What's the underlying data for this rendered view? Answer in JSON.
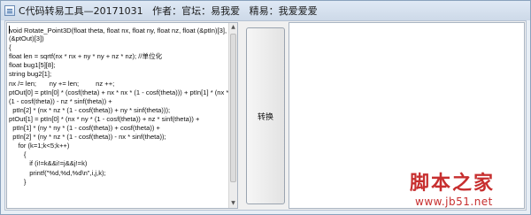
{
  "window": {
    "title": "C代码转易工具—20171031   作者：官坛：易我爱   精易：我爱爱爱"
  },
  "editor": {
    "lines": [
      "void Rotate_Point3D(float theta, float nx, float ny, float nz, float (&ptIn)[3], float",
      "(&ptOut)[3])",
      "{",
      "float len = sqrtf(nx * nx + ny * ny + nz * nz); //单位化",
      "float bug1[5][8];",
      "string bug2[1];",
      "nx /= len;       ny += len;         nz ++;",
      "ptOut[0] = ptIn[0] * (cosf(theta) + nx * nx * (1 - cosf(theta))) + ptIn[1] * (nx * ny *",
      "(1 - cosf(theta)) - nz * sinf(theta)) +",
      "  ptIn[2] * (nx * nz * (1 - cosf(theta)) + ny * sinf(theta)));",
      "ptOut[1] = ptIn[0] * (nx * ny * (1 - cosf(theta)) + nz * sinf(theta)) +",
      "  ptIn[1] * (ny * ny * (1 - cosf(theta)) + cosf(theta)) +",
      "  ptIn[2] * (ny * nz * (1 - cosf(theta)) - nx * sinf(theta));",
      "     for (k=1;k<5;k++)",
      "        {",
      "           if (i!=k&&i!=j&&j!=k)",
      "           printf(\"%d,%d,%d\\n\",i,j,k);",
      "        }"
    ]
  },
  "convert_button": {
    "label": "转换"
  },
  "output": {
    "value": ""
  },
  "watermark": {
    "brand": "脚本之家",
    "url": "www.jb51.net"
  }
}
